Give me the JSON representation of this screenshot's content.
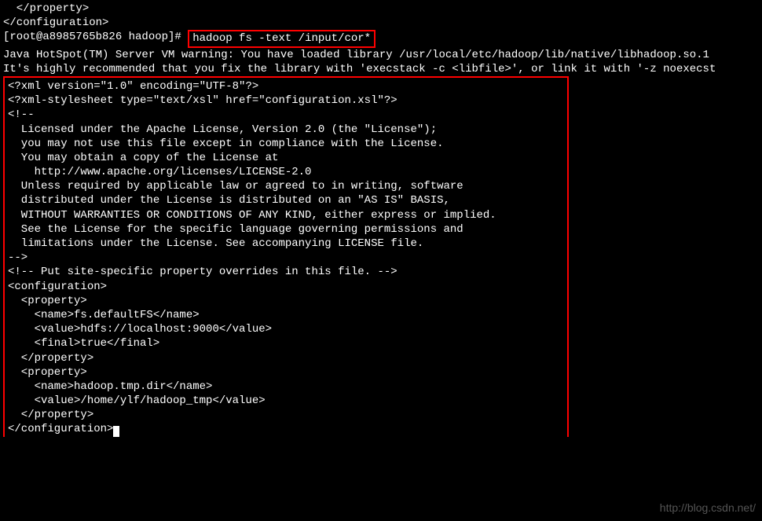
{
  "pre": {
    "line1": "  </property>",
    "line2": "</configuration>",
    "prompt": "[root@a8985765b826 hadoop]# ",
    "command": "hadoop fs -text /input/cor*",
    "warn1": "Java HotSpot(TM) Server VM warning: You have loaded library /usr/local/etc/hadoop/lib/native/libhadoop.so.1",
    "warn2": "It's highly recommended that you fix the library with 'execstack -c <libfile>', or link it with '-z noexecst"
  },
  "xml": {
    "l01": "<?xml version=\"1.0\" encoding=\"UTF-8\"?>",
    "l02": "<?xml-stylesheet type=\"text/xsl\" href=\"configuration.xsl\"?>",
    "l03": "<!--",
    "l04": "  Licensed under the Apache License, Version 2.0 (the \"License\");",
    "l05": "  you may not use this file except in compliance with the License.",
    "l06": "  You may obtain a copy of the License at",
    "l07": "",
    "l08": "    http://www.apache.org/licenses/LICENSE-2.0",
    "l09": "",
    "l10": "  Unless required by applicable law or agreed to in writing, software",
    "l11": "  distributed under the License is distributed on an \"AS IS\" BASIS,",
    "l12": "  WITHOUT WARRANTIES OR CONDITIONS OF ANY KIND, either express or implied.",
    "l13": "  See the License for the specific language governing permissions and",
    "l14": "  limitations under the License. See accompanying LICENSE file.",
    "l15": "-->",
    "l16": "",
    "l17": "<!-- Put site-specific property overrides in this file. -->",
    "l18": "",
    "l19": "<configuration>",
    "l20": "  <property>",
    "l21": "    <name>fs.defaultFS</name>",
    "l22": "    <value>hdfs://localhost:9000</value>",
    "l23": "    <final>true</final>",
    "l24": "  </property>",
    "l25": "",
    "l26": "  <property>",
    "l27": "    <name>hadoop.tmp.dir</name>",
    "l28": "    <value>/home/ylf/hadoop_tmp</value>",
    "l29": "  </property>",
    "l30": "</configuration>"
  },
  "watermark": "http://blog.csdn.net/"
}
